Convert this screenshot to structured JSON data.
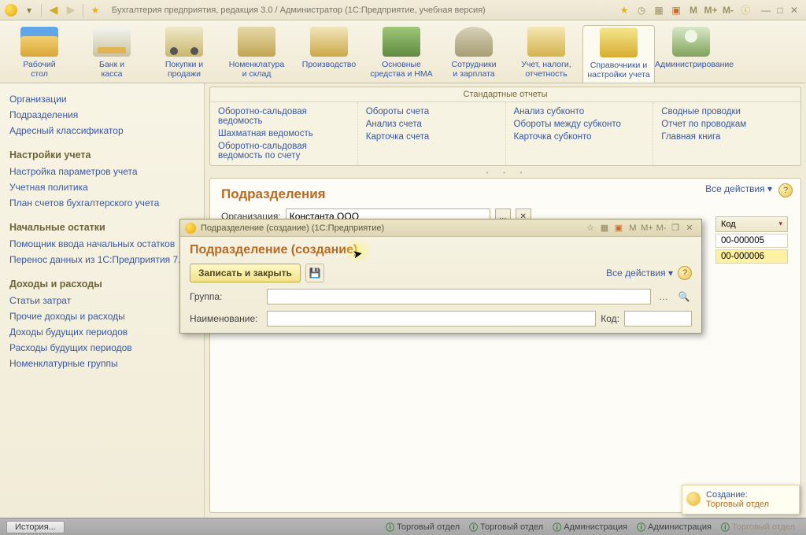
{
  "titlebar": {
    "title": "Бухгалтерия предприятия, редакция 3.0 / Администратор   (1С:Предприятие, учебная версия)",
    "m_labels": [
      "M",
      "M+",
      "M-"
    ]
  },
  "toolbar": [
    {
      "label": "Рабочий\nстол",
      "cls": "ico-desk"
    },
    {
      "label": "Банк и\nкасса",
      "cls": "ico-bank"
    },
    {
      "label": "Покупки и\nпродажи",
      "cls": "ico-cart"
    },
    {
      "label": "Номенклатура\nи склад",
      "cls": "ico-stock"
    },
    {
      "label": "Производство",
      "cls": "ico-prod"
    },
    {
      "label": "Основные\nсредства и НМА",
      "cls": "ico-asset"
    },
    {
      "label": "Сотрудники\nи зарплата",
      "cls": "ico-hr"
    },
    {
      "label": "Учет, налоги,\nотчетность",
      "cls": "ico-tax"
    },
    {
      "label": "Справочники и\nнастройки учета",
      "cls": "ico-ref",
      "active": true
    },
    {
      "label": "Администрирование",
      "cls": "ico-admin"
    }
  ],
  "side": {
    "top": [
      "Организации",
      "Подразделения",
      "Адресный классификатор"
    ],
    "g1_title": "Настройки учета",
    "g1": [
      "Настройка параметров учета",
      "Учетная политика",
      "План счетов бухгалтерского учета"
    ],
    "g2_title": "Начальные остатки",
    "g2": [
      "Помощник ввода начальных остатков",
      "Перенос данных из 1С:Предприятия 7.7"
    ],
    "g3_title": "Доходы и расходы",
    "g3": [
      "Статьи затрат",
      "Прочие доходы и расходы",
      "Доходы будущих периодов",
      "Расходы будущих периодов",
      "Номенклатурные группы"
    ]
  },
  "reports": {
    "header": "Стандартные отчеты",
    "col1": [
      "Оборотно-сальдовая ведомость",
      "Шахматная ведомость",
      "Оборотно-сальдовая ведомость по счету"
    ],
    "col2": [
      "Обороты счета",
      "Анализ счета",
      "Карточка счета"
    ],
    "col3": [
      "Анализ субконто",
      "Обороты между субконто",
      "Карточка субконто"
    ],
    "col4": [
      "Сводные проводки",
      "Отчет по проводкам",
      "Главная книга"
    ]
  },
  "page": {
    "title": "Подразделения",
    "org_label": "Организация:",
    "org_value": "Константа ООО",
    "all_actions": "Все действия ▾",
    "grid_header": "Код",
    "rows": [
      "00-000005",
      "00-000006"
    ]
  },
  "modal": {
    "wintitle": "Подразделение (создание)  (1С:Предприятие)",
    "m_labels": [
      "M",
      "M+",
      "M-"
    ],
    "heading": "Подразделение (создание)",
    "save_close": "Записать и закрыть",
    "all_actions": "Все действия ▾",
    "group_label": "Группа:",
    "name_label": "Наименование:",
    "code_label": "Код:"
  },
  "status": {
    "history": "История...",
    "items": [
      "Торговый отдел",
      "Торговый отдел",
      "Администрация",
      "Администрация",
      "Торговый отдел"
    ]
  },
  "tooltip": {
    "title": "Создание:",
    "link": "Торговый отдел"
  }
}
